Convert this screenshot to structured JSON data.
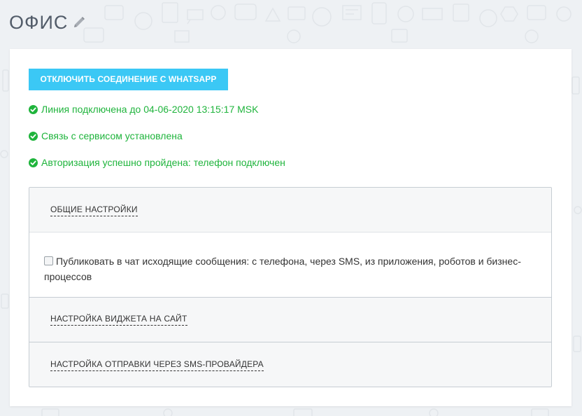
{
  "header": {
    "title": "ОФИС"
  },
  "connection": {
    "disconnect_label": "ОТКЛЮЧИТЬ СОЕДИНЕНИЕ С WHATSAPP",
    "status_items": [
      "Линия подключена до 04-06-2020 13:15:17 MSK",
      "Связь с сервисом установлена",
      "Авторизация успешно пройдена: телефон подключен"
    ]
  },
  "sections": [
    {
      "title": "ОБЩИЕ НАСТРОЙКИ",
      "options": [
        {
          "label": "Публиковать в чат исходящие сообщения: с телефона, через SMS, из приложения, роботов и бизнес-процессов",
          "checked": false
        }
      ]
    },
    {
      "title": "НАСТРОЙКА ВИДЖЕТА НА САЙТ"
    },
    {
      "title": "НАСТРОЙКА ОТПРАВКИ ЧЕРЕЗ SMS-ПРОВАЙДЕРА"
    }
  ],
  "colors": {
    "accent": "#3bc8f5",
    "success": "#1fb43c",
    "title_text": "#525c69"
  },
  "icons": {
    "edit": "pencil-icon",
    "status": "check-circle-icon"
  }
}
